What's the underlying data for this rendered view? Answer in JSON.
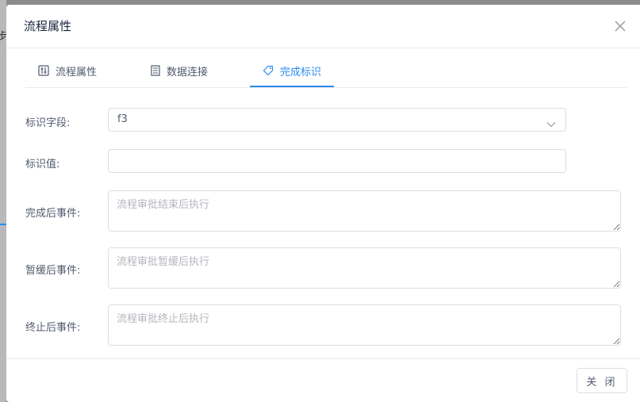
{
  "backdrop": {
    "partial_text": "步"
  },
  "dialog": {
    "title": "流程属性",
    "tabs": [
      {
        "label": "流程属性",
        "icon": "sliders-icon",
        "active": false
      },
      {
        "label": "数据连接",
        "icon": "document-icon",
        "active": false
      },
      {
        "label": "完成标识",
        "icon": "tag-icon",
        "active": true
      }
    ],
    "form": {
      "flag_field": {
        "label": "标识字段:",
        "value": "f3"
      },
      "flag_value": {
        "label": "标识值:",
        "value": ""
      },
      "complete_event": {
        "label": "完成后事件:",
        "placeholder": "流程审批结束后执行"
      },
      "pause_event": {
        "label": "暂缓后事件:",
        "placeholder": "流程审批暂缓后执行"
      },
      "terminate_event": {
        "label": "终止后事件:",
        "placeholder": "流程审批终止后执行"
      }
    },
    "footer": {
      "close_label": "关 闭"
    }
  },
  "colors": {
    "accent": "#2d8cf0",
    "border": "#dcdee2",
    "overlay": "#8c8c8c"
  }
}
